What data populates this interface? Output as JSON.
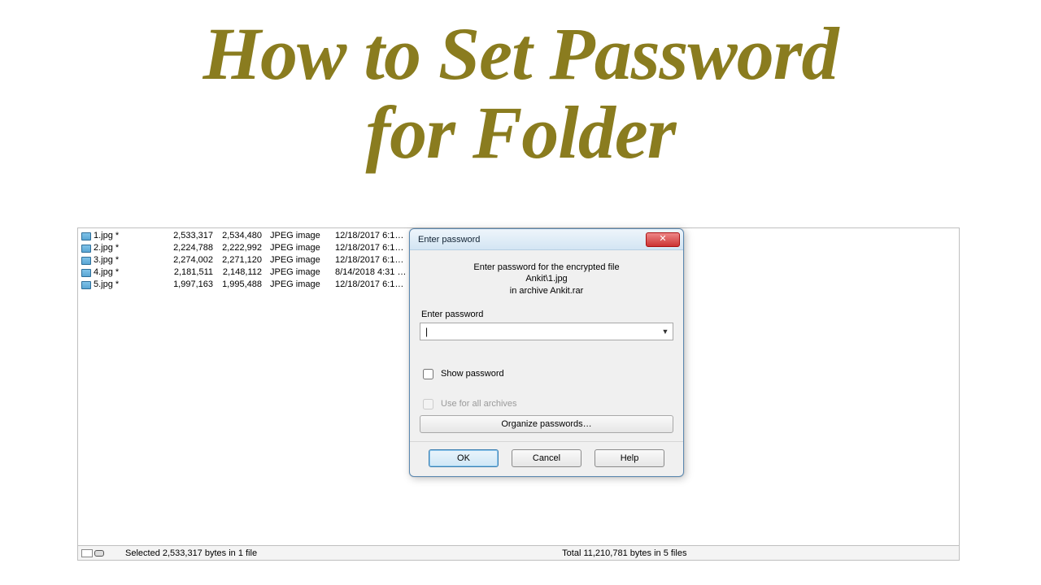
{
  "headline": {
    "line1": "How to Set Password",
    "line2": "for Folder"
  },
  "files": [
    {
      "name": "1.jpg *",
      "size": "2,533,317",
      "packed": "2,534,480",
      "type": "JPEG image",
      "modified": "12/18/2017 6:1…"
    },
    {
      "name": "2.jpg *",
      "size": "2,224,788",
      "packed": "2,222,992",
      "type": "JPEG image",
      "modified": "12/18/2017 6:1…"
    },
    {
      "name": "3.jpg *",
      "size": "2,274,002",
      "packed": "2,271,120",
      "type": "JPEG image",
      "modified": "12/18/2017 6:1…"
    },
    {
      "name": "4.jpg *",
      "size": "2,181,511",
      "packed": "2,148,112",
      "type": "JPEG image",
      "modified": "8/14/2018 4:31 …"
    },
    {
      "name": "5.jpg *",
      "size": "1,997,163",
      "packed": "1,995,488",
      "type": "JPEG image",
      "modified": "12/18/2017 6:1…"
    }
  ],
  "status": {
    "selected": "Selected 2,533,317 bytes in 1 file",
    "total": "Total 11,210,781 bytes in 5 files"
  },
  "dialog": {
    "title": "Enter password",
    "msg_line1": "Enter password for the encrypted file",
    "msg_line2": "Ankit\\1.jpg",
    "msg_line3": "in archive Ankit.rar",
    "label": "Enter password",
    "input_value": "|",
    "show_pwd": "Show password",
    "use_all": "Use for all archives",
    "organize": "Organize passwords…",
    "ok": "OK",
    "cancel": "Cancel",
    "help": "Help"
  }
}
